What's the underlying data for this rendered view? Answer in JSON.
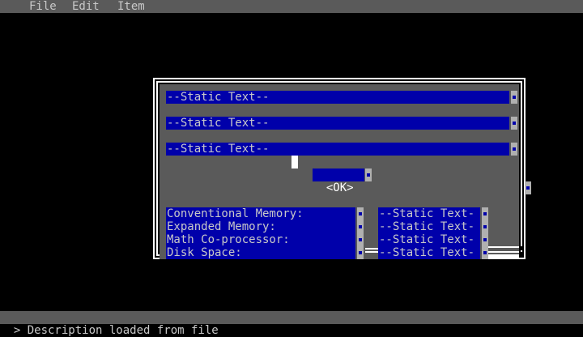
{
  "menu": {
    "items": [
      "File",
      "Edit",
      "Item"
    ]
  },
  "dialog": {
    "static_fields": [
      "--Static Text--",
      "--Static Text--",
      "--Static Text--"
    ],
    "ok_label": "<OK>",
    "info_labels": [
      "Conventional Memory:",
      "Expanded Memory:",
      "Math Co-processor:",
      "Disk Space:"
    ],
    "info_values": [
      "--Static Text-",
      "--Static Text-",
      "--Static Text-",
      "--Static Text-"
    ]
  },
  "status_bar": {
    "text": "> Description loaded from file"
  },
  "colors": {
    "background": "#000000",
    "bar": "#5a5a5a",
    "dialog_body": "#5a5a5a",
    "field": "#0000aa",
    "text": "#c8c8c8"
  }
}
